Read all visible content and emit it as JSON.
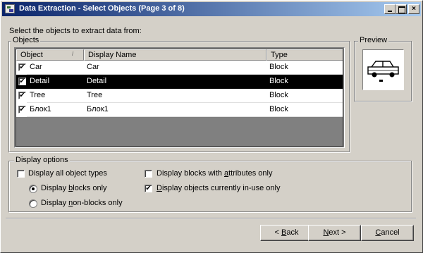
{
  "window": {
    "title": "Data Extraction - Select Objects (Page 3 of 8)",
    "controls": {
      "close": "×"
    }
  },
  "instruction": "Select the objects to extract data from:",
  "objects_group": {
    "legend": "Objects",
    "columns": [
      "Object",
      "Display Name",
      "Type"
    ],
    "rows": [
      {
        "checked": true,
        "object": "Car",
        "display_name": "Car",
        "type": "Block",
        "selected": false
      },
      {
        "checked": true,
        "object": "Detail",
        "display_name": "Detail",
        "type": "Block",
        "selected": true
      },
      {
        "checked": true,
        "object": "Tree",
        "display_name": "Tree",
        "type": "Block",
        "selected": false
      },
      {
        "checked": true,
        "object": "Блок1",
        "display_name": "Блок1",
        "type": "Block",
        "selected": false
      }
    ],
    "checkmark": "✔"
  },
  "preview": {
    "legend": "Preview",
    "icon": "car-block-icon"
  },
  "display_options": {
    "legend": "Display options",
    "all_object_types": {
      "label": "Display all object types",
      "checked": false
    },
    "blocks_only": {
      "pre": "Display ",
      "u": "b",
      "post": "locks only",
      "selected": true
    },
    "non_blocks_only": {
      "pre": "Display ",
      "u": "n",
      "post": "on-blocks only",
      "selected": false
    },
    "blocks_with_attributes": {
      "pre": "Display blocks with ",
      "u": "a",
      "post": "ttributes only",
      "checked": false
    },
    "in_use_only": {
      "pre": "",
      "u": "D",
      "post": "isplay objects currently in-use only",
      "checked": true
    }
  },
  "buttons": {
    "back": {
      "pre": "< ",
      "u": "B",
      "post": "ack"
    },
    "next": {
      "pre": "",
      "u": "N",
      "post": "ext >"
    },
    "cancel": {
      "pre": "",
      "u": "C",
      "post": "ancel"
    }
  },
  "colors": {
    "titlebar_start": "#0a246a",
    "titlebar_end": "#a6caf0",
    "face": "#d4d0c8",
    "selection": "#000000"
  }
}
